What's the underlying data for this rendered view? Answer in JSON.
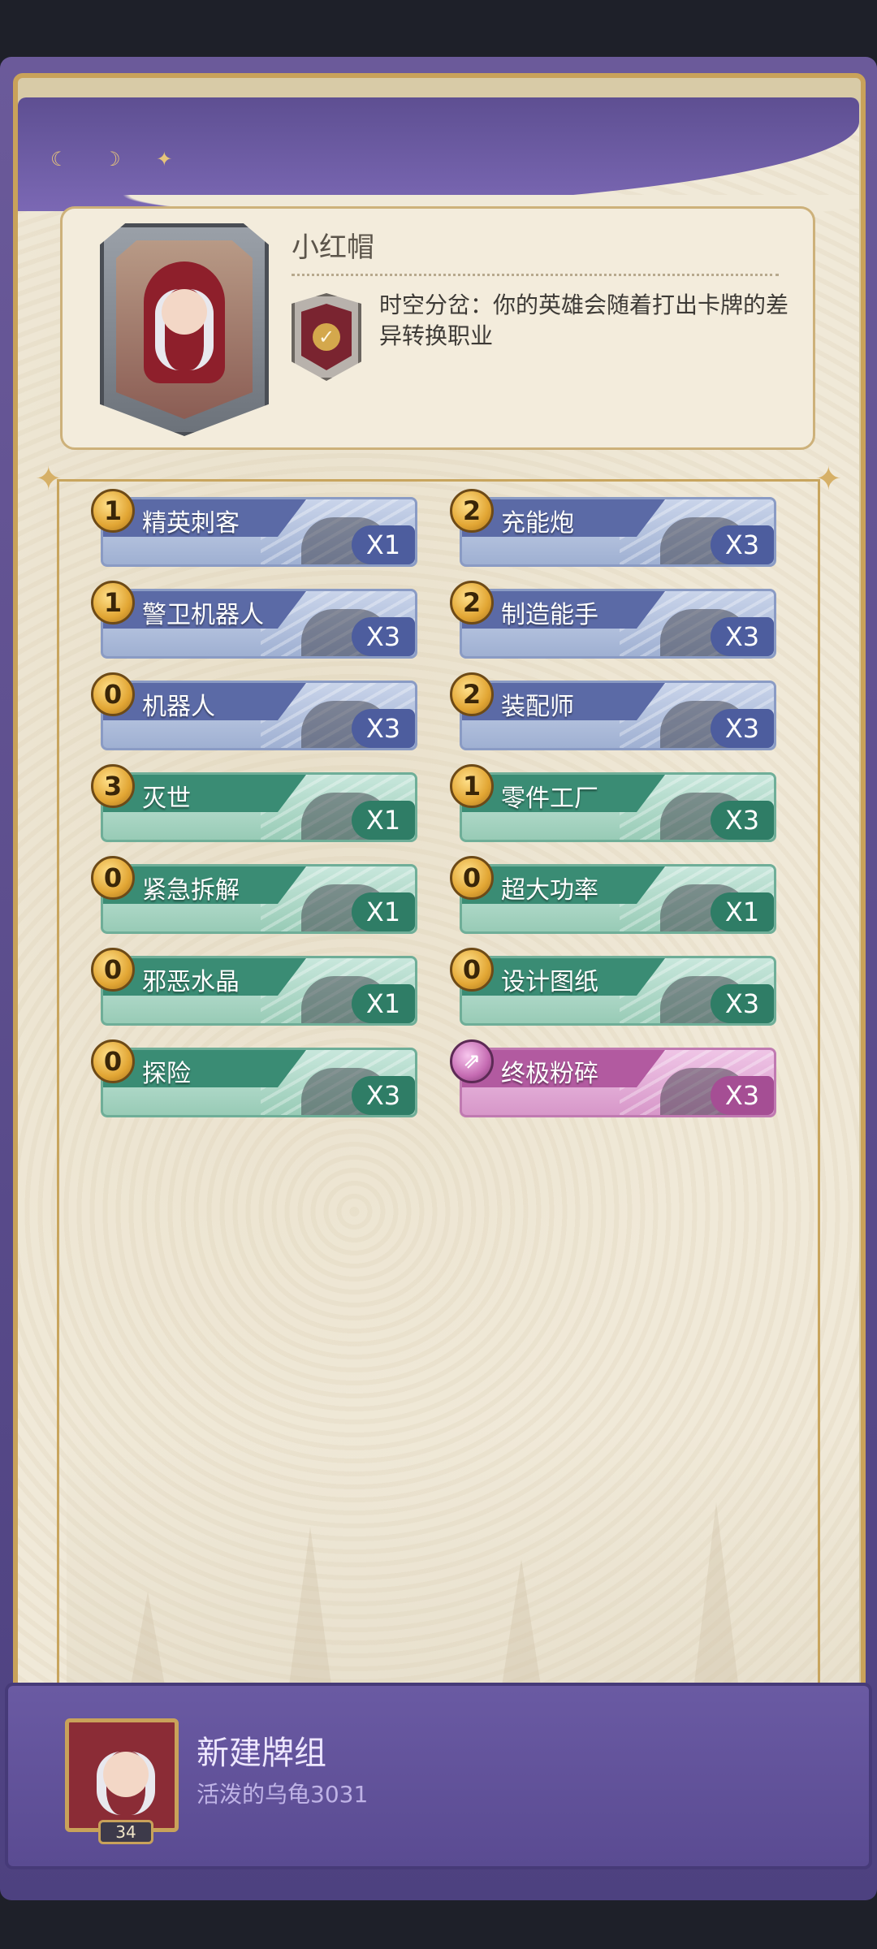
{
  "hero": {
    "name": "小红帽",
    "skill_text": "时空分岔：你的英雄会随着打出卡牌的差异转换职业"
  },
  "cards": [
    {
      "cost": "1",
      "name": "精英刺客",
      "count": "X1",
      "color": "blue"
    },
    {
      "cost": "2",
      "name": "充能炮",
      "count": "X3",
      "color": "blue"
    },
    {
      "cost": "1",
      "name": "警卫机器人",
      "count": "X3",
      "color": "blue"
    },
    {
      "cost": "2",
      "name": "制造能手",
      "count": "X3",
      "color": "blue"
    },
    {
      "cost": "0",
      "name": "机器人",
      "count": "X3",
      "color": "blue"
    },
    {
      "cost": "2",
      "name": "装配师",
      "count": "X3",
      "color": "blue"
    },
    {
      "cost": "3",
      "name": "灭世",
      "count": "X1",
      "color": "green"
    },
    {
      "cost": "1",
      "name": "零件工厂",
      "count": "X3",
      "color": "green"
    },
    {
      "cost": "0",
      "name": "紧急拆解",
      "count": "X1",
      "color": "green"
    },
    {
      "cost": "0",
      "name": "超大功率",
      "count": "X1",
      "color": "green"
    },
    {
      "cost": "0",
      "name": "邪恶水晶",
      "count": "X1",
      "color": "green"
    },
    {
      "cost": "0",
      "name": "设计图纸",
      "count": "X3",
      "color": "green"
    },
    {
      "cost": "0",
      "name": "探险",
      "count": "X3",
      "color": "green"
    },
    {
      "cost": "",
      "name": "终极粉碎",
      "count": "X3",
      "color": "pink"
    }
  ],
  "deck": {
    "title": "新建牌组",
    "owner": "活泼的乌龟3031",
    "level": "34"
  },
  "colors": {
    "blue_card": "#9fb0d2",
    "green_card": "#98cbb6",
    "pink_card": "#d797c9",
    "gold": "#e2a634",
    "purple_frame": "#5e4f92"
  }
}
